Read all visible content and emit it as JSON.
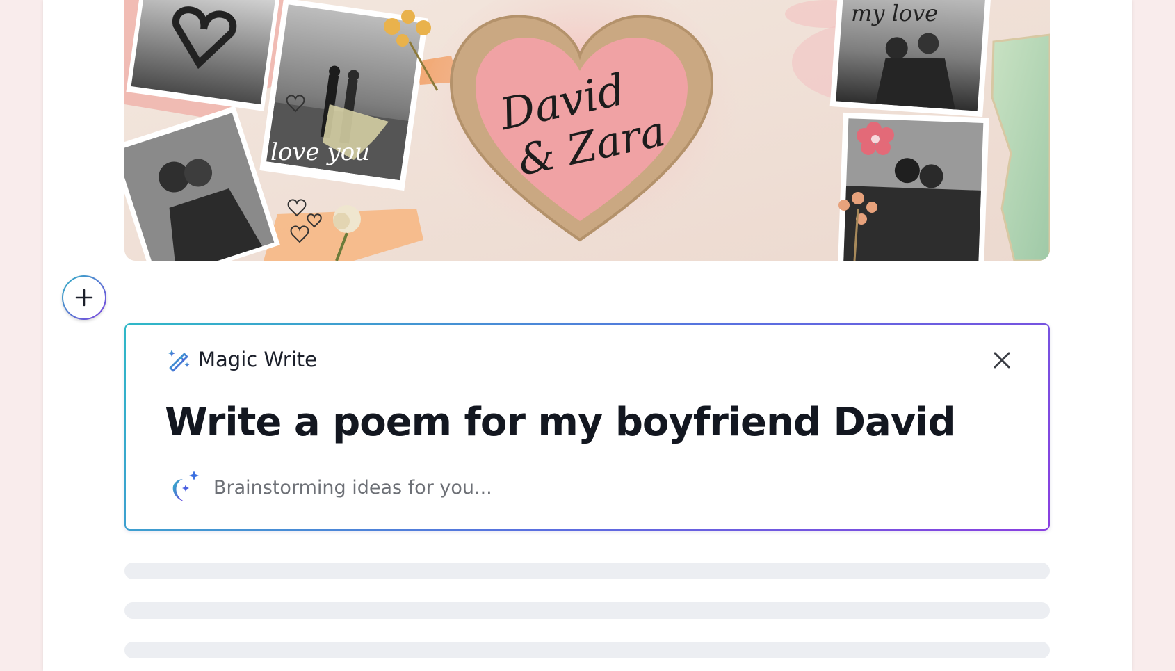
{
  "hero": {
    "heart_text_line1": "David",
    "heart_text_line2": "& Zara",
    "photo_caption_love_you": "love you",
    "corner_text_my_love": "my love"
  },
  "add_block": {
    "icon": "plus-icon"
  },
  "magic_write": {
    "title": "Magic Write",
    "title_icon": "magic-wand-icon",
    "close_icon": "close-icon",
    "prompt": "Write a poem for my boyfriend David",
    "status": "Brainstorming ideas for you...",
    "status_icon": "moon-sparkle-icon"
  },
  "colors": {
    "accent_teal": "#2fb8c7",
    "accent_purple": "#8a3fe0",
    "page_background": "#f9ecec",
    "skeleton": "#eceef2"
  }
}
